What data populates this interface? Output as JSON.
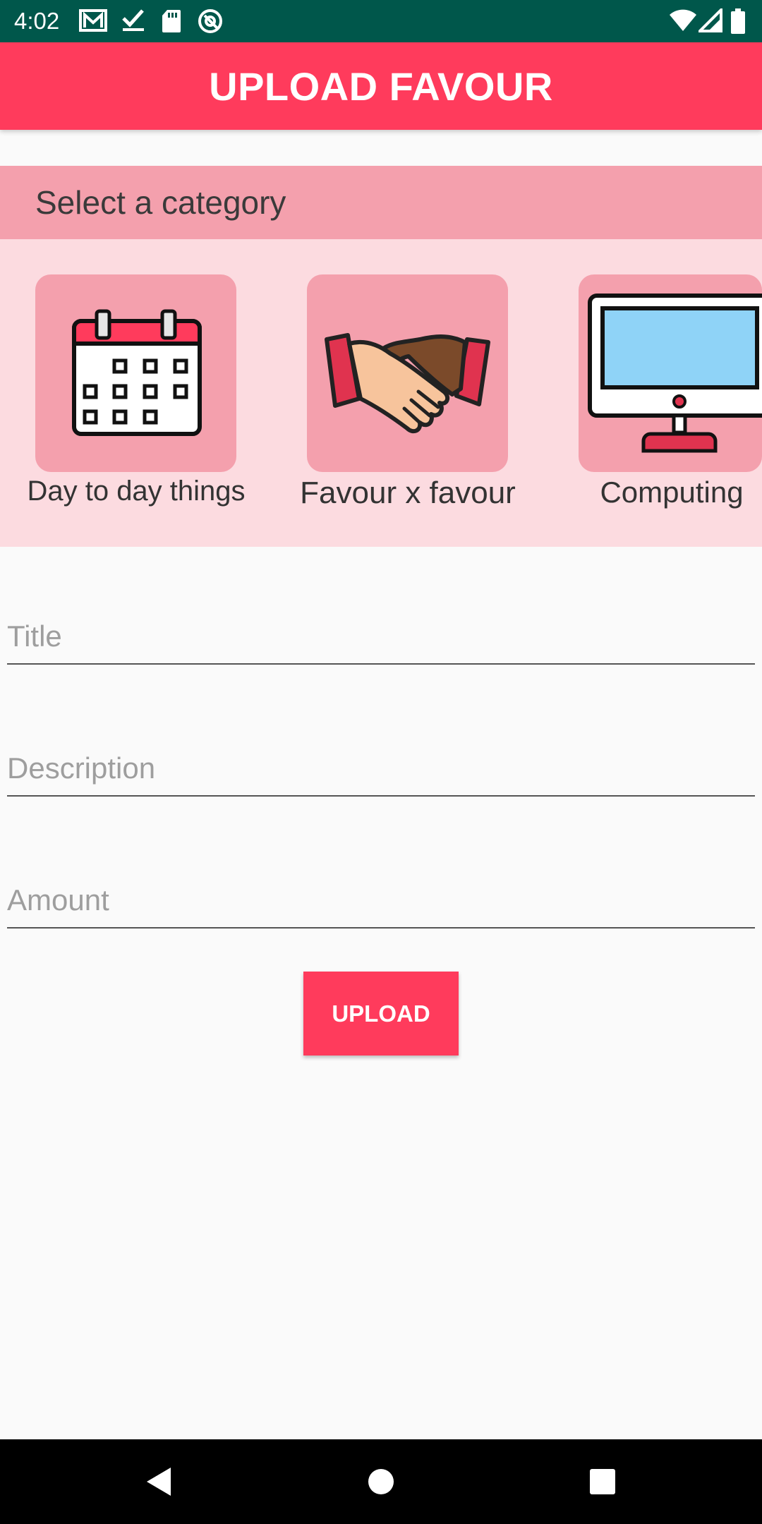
{
  "status_bar": {
    "time": "4:02",
    "icons": [
      "gmail-icon",
      "check-icon",
      "sd-card-icon",
      "at-sign-icon",
      "wifi-icon",
      "signal-icon",
      "battery-icon"
    ],
    "background": "#00574b"
  },
  "app_bar": {
    "title": "UPLOAD FAVOUR",
    "background": "#ff3b5c"
  },
  "category_section": {
    "header": "Select a category",
    "items": [
      {
        "label": "Day to day things",
        "icon": "calendar-icon"
      },
      {
        "label": "Favour x favour",
        "icon": "handshake-icon"
      },
      {
        "label": "Computing",
        "icon": "monitor-icon"
      }
    ]
  },
  "form": {
    "title_placeholder": "Title",
    "description_placeholder": "Description",
    "amount_placeholder": "Amount"
  },
  "upload_button": {
    "label": "UPLOAD"
  },
  "nav_bar": {
    "buttons": [
      "back-icon",
      "home-icon",
      "recents-icon"
    ]
  },
  "colors": {
    "accent": "#ff3b5c",
    "category_header_bg": "#f4a0ad",
    "category_strip_bg": "#fcdbe0"
  }
}
